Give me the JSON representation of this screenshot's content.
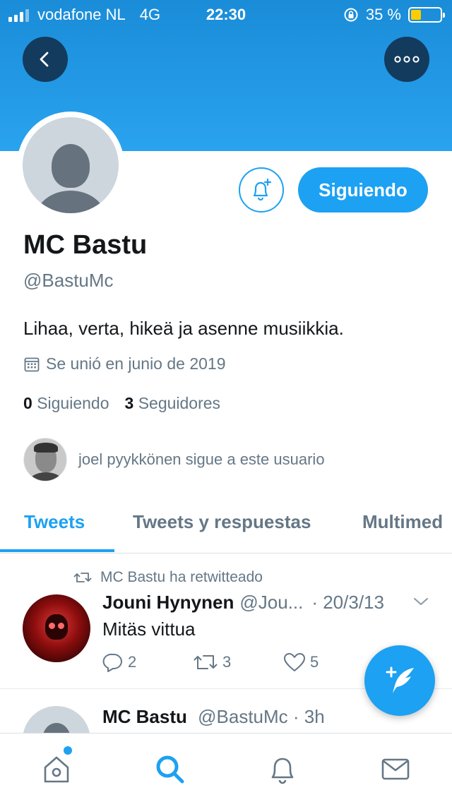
{
  "status_bar": {
    "carrier": "vodafone NL",
    "network": "4G",
    "time": "22:30",
    "battery_percent": "35 %",
    "battery_level": 0.35
  },
  "profile": {
    "display_name": "MC Bastu",
    "handle": "@BastuMc",
    "bio": "Lihaa, verta, hikeä ja asenne musiikkia.",
    "joined": "Se unió en junio de 2019",
    "following_count": "0",
    "following_label": "Siguiendo",
    "followers_count": "3",
    "followers_label": "Seguidores",
    "followed_by": "joel pyykkönen sigue a este usuario",
    "follow_button_label": "Siguiendo"
  },
  "tabs": [
    {
      "label": "Tweets",
      "active": true
    },
    {
      "label": "Tweets y respuestas",
      "active": false
    },
    {
      "label": "Multimed",
      "active": false
    }
  ],
  "tweets": [
    {
      "retweet_note": "MC Bastu ha retwitteado",
      "author": "Jouni Hynynen",
      "handle": "@Jou...",
      "date": "· 20/3/13",
      "text": "Mitäs vittua",
      "replies": "2",
      "retweets": "3",
      "likes": "5"
    },
    {
      "author": "MC Bastu",
      "handle": "@BastuMc",
      "date": "· 3h"
    }
  ],
  "colors": {
    "accent": "#1da1f2",
    "banner": "#2aa3ef",
    "dark_button": "#133b5e",
    "secondary_text": "#657786"
  },
  "icons": {
    "back": "back-arrow-icon",
    "more": "more-dots-icon",
    "notify": "bell-plus-icon",
    "calendar": "calendar-icon",
    "retweet": "retweet-icon",
    "reply": "reply-icon",
    "like": "heart-icon",
    "compose": "compose-feather-icon",
    "home": "home-icon",
    "search": "search-icon",
    "notifications": "notifications-bell-icon",
    "messages": "messages-envelope-icon"
  }
}
